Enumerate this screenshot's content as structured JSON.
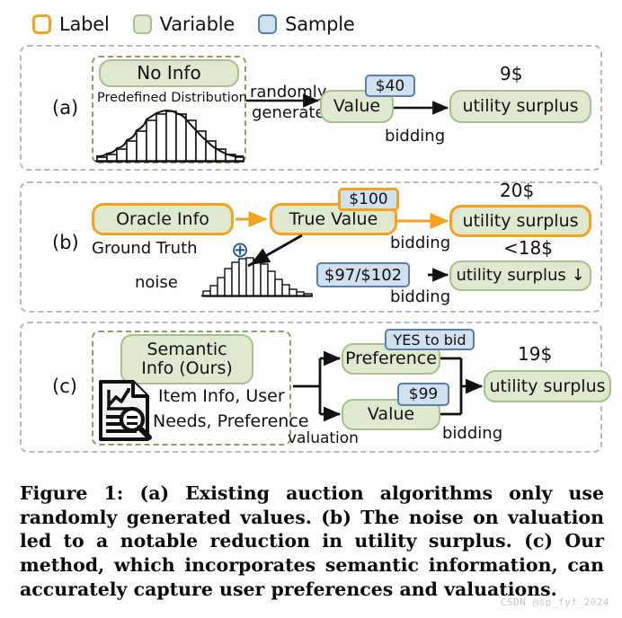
{
  "legend": {
    "items": [
      {
        "label": "Label",
        "kind": "label",
        "color": "#f5a21e"
      },
      {
        "label": "Variable",
        "kind": "variable",
        "color": "#a8bf8e"
      },
      {
        "label": "Sample",
        "kind": "sample",
        "color": "#5a7fa8"
      }
    ]
  },
  "panel_a": {
    "tag": "(a)",
    "group_title": "No Info",
    "group_subtitle": "Predefined Distribution",
    "histogram_name": "bell-curve-histogram",
    "arrow_label_line1": "randomly",
    "arrow_label_line2": "generate",
    "value_node": "Value",
    "value_badge": "$40",
    "bidding_label": "bidding",
    "outcome_node": "utility surplus",
    "outcome_amount": "9$"
  },
  "panel_b": {
    "tag": "(b)",
    "oracle_node": "Oracle Info",
    "ground_truth_label": "Ground Truth",
    "true_value_node": "True Value",
    "true_value_badge": "$100",
    "plus_symbol": "⊕",
    "noise_label": "noise",
    "histogram_name": "skewed-noise-histogram",
    "noisy_badge": "$97/$102",
    "bidding_label_top": "bidding",
    "bidding_label_bottom": "bidding",
    "outcome_top_node": "utility surplus",
    "outcome_top_amount": "20$",
    "outcome_bottom_node": "utility surplus ↓",
    "outcome_bottom_amount": "<18$"
  },
  "panel_c": {
    "tag": "(c)",
    "group_title_line1": "Semantic",
    "group_title_line2": "Info (Ours)",
    "doc_icon_name": "document-chart-search-icon",
    "desc_line1": "Item Info, User",
    "desc_line2": "Needs, Preference",
    "valuation_label": "valuation",
    "preference_node": "Preference",
    "preference_badge": "YES to bid",
    "value_node": "Value",
    "value_badge": "$99",
    "bidding_label": "bidding",
    "outcome_node": "utility surplus",
    "outcome_amount": "19$"
  },
  "caption": "Figure 1: (a) Existing auction algorithms only use randomly generated values. (b) The noise on valuation led to a notable reduction in utility surplus. (c) Our method, which incorporates semantic information, can accurately capture user preferences and valuations.",
  "watermark": "CSDN @sp_fyf_2024"
}
